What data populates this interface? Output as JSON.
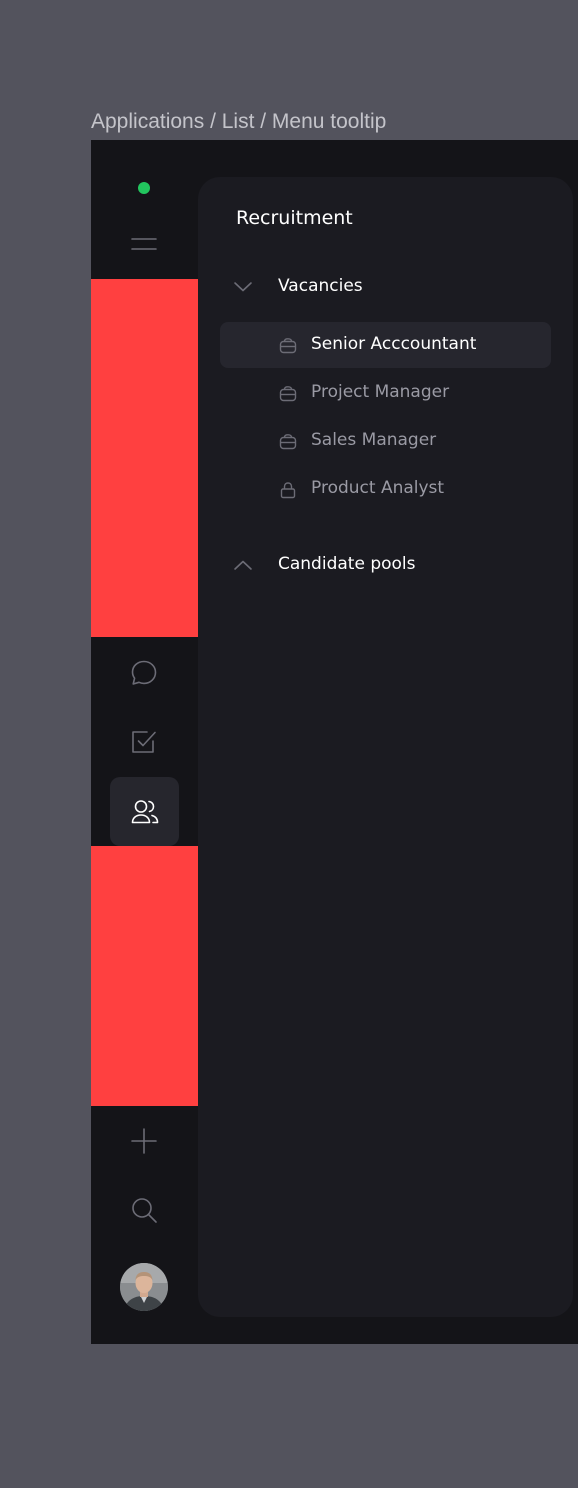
{
  "breadcrumb": "Applications / List / Menu tooltip",
  "colors": {
    "background": "#53535d",
    "frame": "#141418",
    "panel": "#1b1b21",
    "selected_row": "#26262e",
    "status_dot": "#22c55e",
    "placeholder": "#ff4040",
    "text_primary": "#ffffff",
    "text_secondary": "#9a9aa4"
  },
  "rail": {
    "icons": [
      "status-dot",
      "menu-icon",
      "chat-icon",
      "checkbox-icon",
      "users-icon",
      "plus-icon",
      "search-icon",
      "avatar"
    ],
    "active": "users-icon"
  },
  "panel": {
    "title": "Recruitment",
    "groups": [
      {
        "label": "Vacancies",
        "expanded": true,
        "chevron": "chevron-down-icon",
        "items": [
          {
            "label": "Senior Acccountant",
            "icon": "briefcase-icon",
            "selected": true
          },
          {
            "label": "Project Manager",
            "icon": "briefcase-icon",
            "selected": false
          },
          {
            "label": "Sales Manager",
            "icon": "briefcase-icon",
            "selected": false
          },
          {
            "label": "Product Analyst",
            "icon": "lock-icon",
            "selected": false
          }
        ]
      },
      {
        "label": "Candidate pools",
        "expanded": false,
        "chevron": "chevron-up-icon",
        "items": []
      }
    ]
  }
}
